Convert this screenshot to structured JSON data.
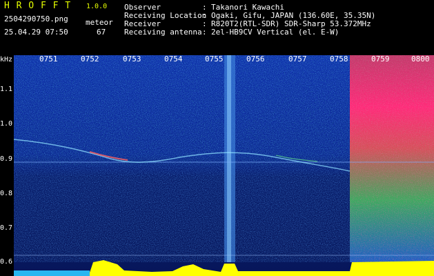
{
  "app": {
    "name": "H R O F F T",
    "version": "1.0.0"
  },
  "file": {
    "name": "2504290750.png",
    "datetime": "25.04.29 07:50"
  },
  "counter": {
    "label": "meteor",
    "value": "67"
  },
  "info": [
    {
      "label": "Observer",
      "sep": ":",
      "value": "Takanori Kawachi"
    },
    {
      "label": "Receiving Location",
      "sep": ":",
      "value": "Ogaki, Gifu, JAPAN (136.60E, 35.35N)"
    },
    {
      "label": "Receiver",
      "sep": ":",
      "value": "R820T2(RTL-SDR) SDR-Sharp 53.372MHz"
    },
    {
      "label": "Receiving antenna",
      "sep": ":",
      "value": "2el-HB9CV Vertical (el. E-W)"
    }
  ],
  "y_axis": {
    "unit": "kHz",
    "ticks": [
      "1.1",
      "1.0",
      "0.9",
      "0.8",
      "0.7",
      "0.6"
    ]
  },
  "time_axis": [
    "0751",
    "0752",
    "0753",
    "0754",
    "0755",
    "0756",
    "0757",
    "0758",
    "0759",
    "0800"
  ],
  "colors": {
    "background": "#000000",
    "title": "#e6ff00",
    "text": "#ffffff",
    "spectrum_low": "#0a1a6e",
    "spectrum_high": "#ff2080",
    "baseline": "#ffff00"
  }
}
